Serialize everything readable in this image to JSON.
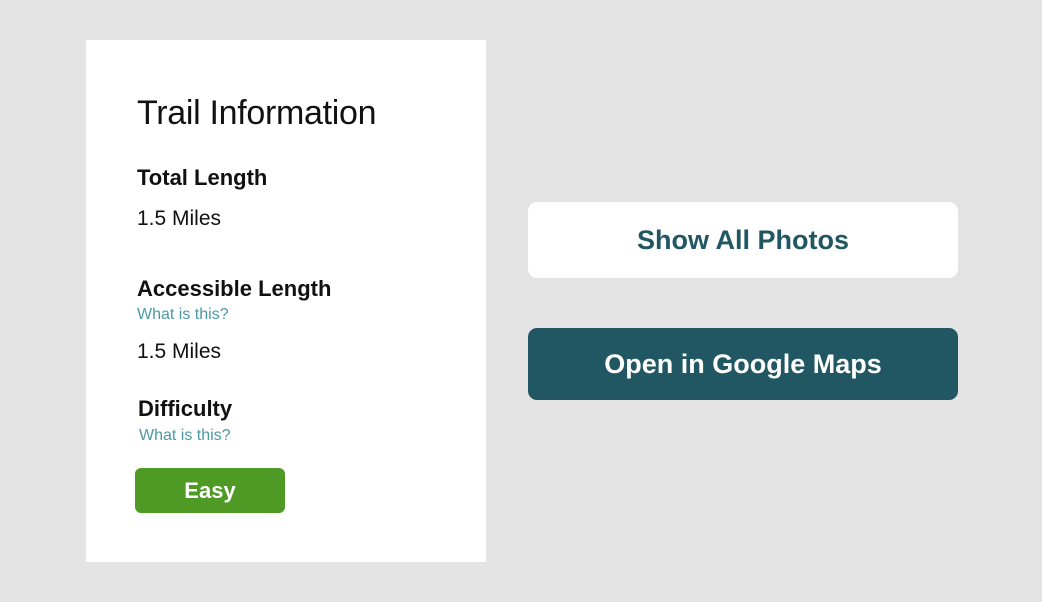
{
  "trail_info": {
    "title": "Trail Information",
    "total_length": {
      "label": "Total Length",
      "value": "1.5 Miles"
    },
    "accessible_length": {
      "label": "Accessible Length",
      "help_link": "What is this?",
      "value": "1.5 Miles"
    },
    "difficulty": {
      "label": "Difficulty",
      "help_link": "What is this?",
      "value": "Easy",
      "badge_color": "#4e9a24"
    }
  },
  "actions": {
    "show_photos_label": "Show All Photos",
    "open_maps_label": "Open in Google Maps"
  },
  "colors": {
    "primary": "#215763",
    "link": "#4b9aa3",
    "background": "#e3e3e3",
    "card": "#ffffff"
  }
}
